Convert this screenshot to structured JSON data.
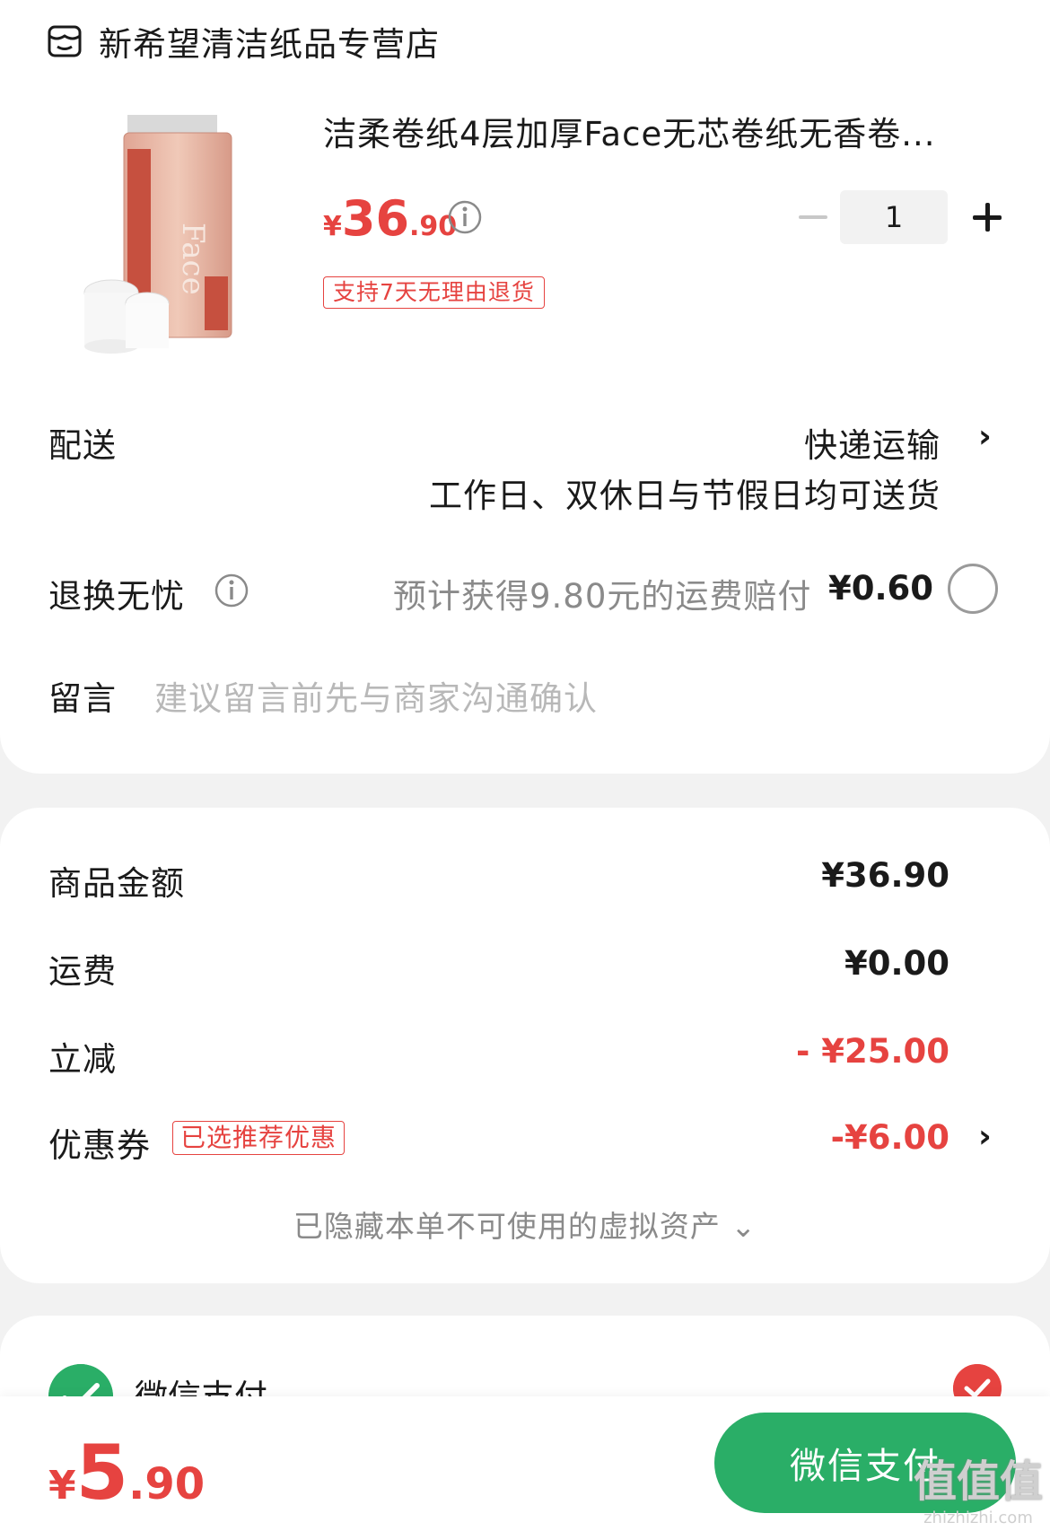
{
  "store": {
    "name": "新希望清洁纸品专营店",
    "icon": "store-icon"
  },
  "product": {
    "title": "洁柔卷纸4层加厚Face无芯卷纸无香卷...",
    "price_currency": "¥",
    "price_int": "36",
    "price_dec": ".90",
    "quantity": "1",
    "return_tag": "支持7天无理由退货"
  },
  "delivery": {
    "label": "配送",
    "method": "快递运输",
    "note": "工作日、双休日与节假日均可送货"
  },
  "return_insurance": {
    "label": "退换无忧",
    "desc": "预计获得9.80元的运费赔付",
    "price": "¥0.60"
  },
  "message": {
    "label": "留言",
    "placeholder": "建议留言前先与商家沟通确认"
  },
  "summary": {
    "items": [
      {
        "label": "商品金额",
        "value": "¥36.90"
      },
      {
        "label": "运费",
        "value": "¥0.00"
      },
      {
        "label": "立减",
        "value": "- ¥25.00"
      },
      {
        "label": "优惠券",
        "value": "-¥6.00",
        "tag": "已选推荐优惠"
      }
    ],
    "hidden_note": "已隐藏本单不可使用的虚拟资产 ⌄"
  },
  "payment": {
    "method": "微信支付"
  },
  "footer": {
    "total_currency": "¥",
    "total_int": "5",
    "total_dec": ".90",
    "pay_button": "微信支付",
    "watermark": "值值值",
    "watermark_url": "zhizhizhi.com"
  },
  "colors": {
    "accent_red": "#e64340",
    "wechat_green": "#2aae67"
  }
}
